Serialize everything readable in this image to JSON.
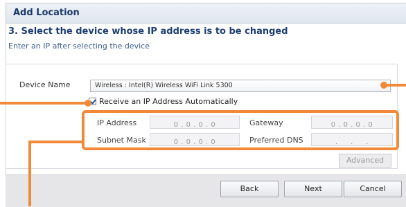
{
  "dialog": {
    "title": "Add Location",
    "step_title": "3. Select the device whose IP address is to be changed",
    "step_subtitle": "Enter an IP after selecting the device"
  },
  "device": {
    "label": "Device Name",
    "selected": "Wireless : Intel(R) Wireless WiFi Link 5300"
  },
  "auto_ip": {
    "label": "Receive an IP Address Automatically",
    "checked": true
  },
  "fields": {
    "ip_address": {
      "label": "IP Address",
      "value": "0 . 0 . 0 . 0"
    },
    "gateway": {
      "label": "Gateway",
      "value": "0 . 0 . 0 . 0"
    },
    "subnet_mask": {
      "label": "Subnet Mask",
      "value": "0 . 0 . 0 . 0"
    },
    "preferred_dns": {
      "label": "Preferred DNS",
      "value": ".     .     ."
    }
  },
  "buttons": {
    "advanced": "Advanced",
    "back": "Back",
    "next": "Next",
    "cancel": "Cancel"
  },
  "colors": {
    "callout": "#f08a3a",
    "title_text": "#1a3a6b"
  }
}
